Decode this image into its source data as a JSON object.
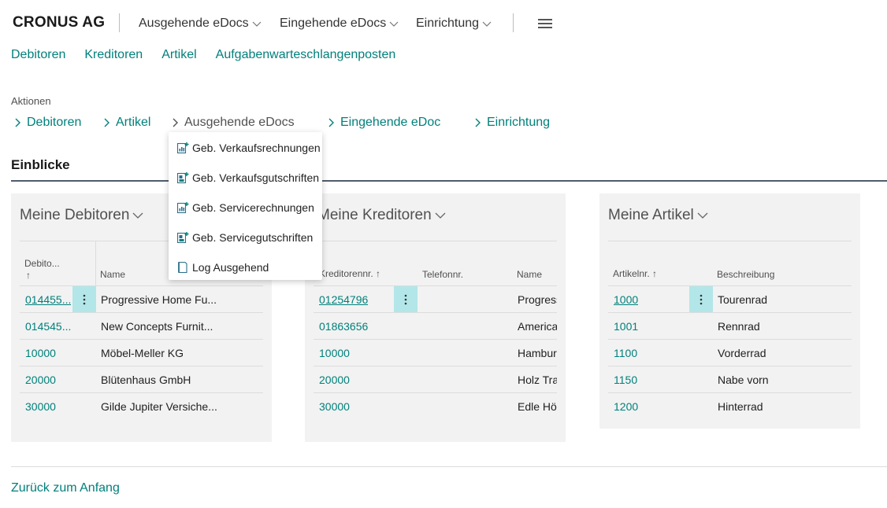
{
  "header": {
    "company": "CRONUS AG",
    "menus": [
      "Ausgehende eDocs",
      "Eingehende eDocs",
      "Einrichtung"
    ]
  },
  "sublinks": [
    "Debitoren",
    "Kreditoren",
    "Artikel",
    "Aufgabenwarteschlangenposten"
  ],
  "actions": {
    "label": "Aktionen",
    "items": [
      "Debitoren",
      "Artikel",
      "Ausgehende eDocs",
      "Eingehende eDoc",
      "Einrichtung"
    ]
  },
  "dropdown": {
    "items": [
      {
        "label": "Geb. Verkaufsrechnungen",
        "icon": "report-icon"
      },
      {
        "label": "Geb. Verkaufsgutschriften",
        "icon": "report-credit-icon"
      },
      {
        "label": "Geb. Servicerechnungen",
        "icon": "report-icon"
      },
      {
        "label": "Geb. Servicegutschriften",
        "icon": "report-credit-icon"
      },
      {
        "label": "Log Ausgehend",
        "icon": "log-page-icon"
      }
    ]
  },
  "insights": {
    "title": "Einblicke"
  },
  "cards": {
    "debitoren": {
      "title": "Meine Debitoren",
      "col1": "Debito...",
      "sort": "↑",
      "col2": "Name",
      "rows": [
        {
          "no": "014455...",
          "name": "Progressive Home Fu..."
        },
        {
          "no": "014545...",
          "name": "New Concepts Furnit..."
        },
        {
          "no": "10000",
          "name": "Möbel-Meller KG"
        },
        {
          "no": "20000",
          "name": "Blütenhaus GmbH"
        },
        {
          "no": "30000",
          "name": "Gilde Jupiter Versiche..."
        }
      ]
    },
    "kreditoren": {
      "title": "Meine Kreditoren",
      "col1": "Kreditorennr. ↑",
      "col2": "Telefonnr.",
      "col3": "Name",
      "rows": [
        {
          "no": "01254796",
          "name": "Progress"
        },
        {
          "no": "01863656",
          "name": "America"
        },
        {
          "no": "10000",
          "name": "Hambur"
        },
        {
          "no": "20000",
          "name": "Holz Tra"
        },
        {
          "no": "30000",
          "name": "Edle Höl"
        }
      ]
    },
    "artikel": {
      "title": "Meine Artikel",
      "col1": "Artikelnr. ↑",
      "col2": "Beschreibung",
      "rows": [
        {
          "no": "1000",
          "name": "Tourenrad"
        },
        {
          "no": "1001",
          "name": "Rennrad"
        },
        {
          "no": "1100",
          "name": "Vorderrad"
        },
        {
          "no": "1150",
          "name": "Nabe vorn"
        },
        {
          "no": "1200",
          "name": "Hinterrad"
        }
      ]
    }
  },
  "footer": {
    "back": "Zurück zum Anfang"
  },
  "colors": {
    "accent": "#00807b",
    "selected": "#b3e6e8",
    "card_bg": "#f2f2f2"
  }
}
